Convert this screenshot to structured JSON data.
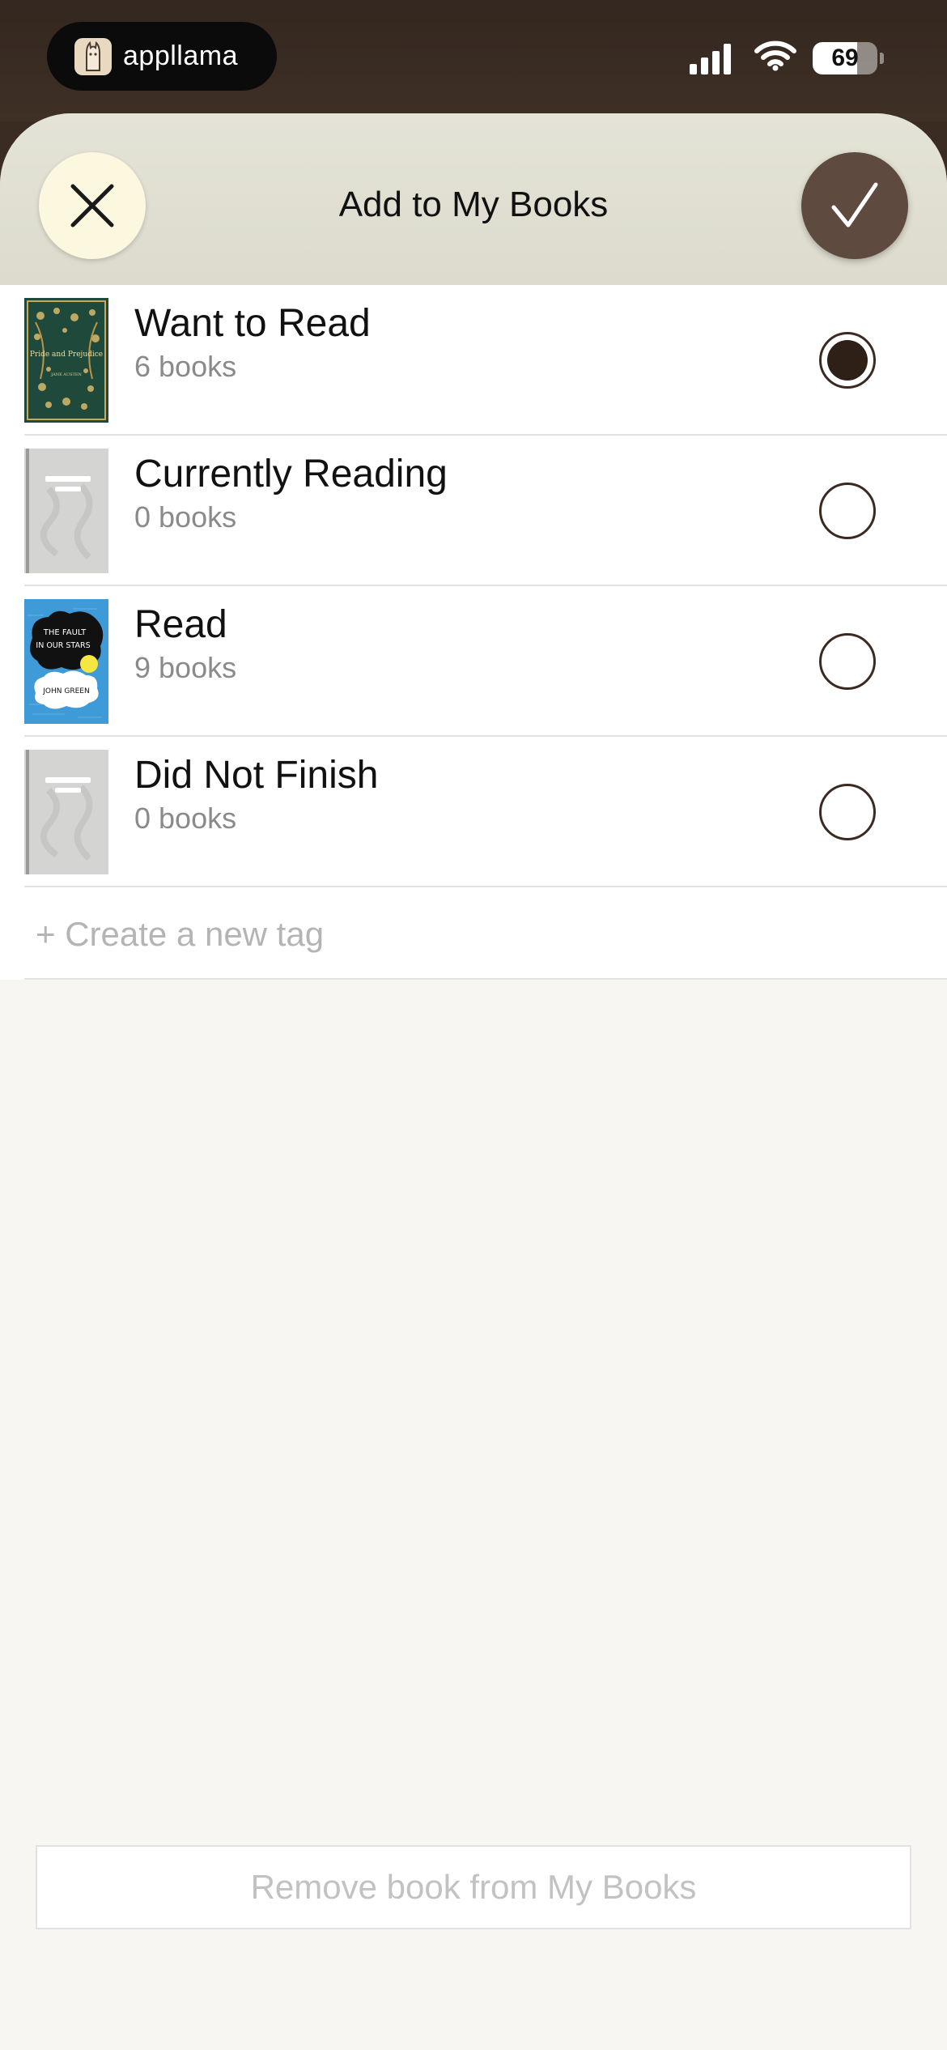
{
  "status_bar": {
    "app_name": "appllama",
    "app_icon": "llama-icon",
    "battery_level": 69,
    "battery_text": "69",
    "signal_icon": "cellular-signal-icon",
    "wifi_icon": "wifi-icon"
  },
  "sheet": {
    "title": "Add to My Books",
    "close_icon": "close-icon",
    "confirm_icon": "checkmark-icon",
    "close_bg": "#fbf8df",
    "confirm_bg": "#5e4a3f"
  },
  "tags": [
    {
      "title": "Want to Read",
      "count": "6 books",
      "selected": true,
      "cover": "pride-and-prejudice-cover"
    },
    {
      "title": "Currently Reading",
      "count": "0 books",
      "selected": false,
      "cover": "placeholder-cover"
    },
    {
      "title": "Read",
      "count": "9 books",
      "selected": false,
      "cover": "the-fault-in-our-stars-cover"
    },
    {
      "title": "Did Not Finish",
      "count": "0 books",
      "selected": false,
      "cover": "placeholder-cover"
    }
  ],
  "covers": {
    "pride_title": "Pride and Prejudice",
    "pride_author": "JANE AUSTEN",
    "fault_title_line1": "THE FAULT",
    "fault_title_line2": "IN OUR STARS",
    "fault_author": "JOHN GREEN"
  },
  "new_tag_label": "+ Create a new tag",
  "remove_label": "Remove book from My Books"
}
